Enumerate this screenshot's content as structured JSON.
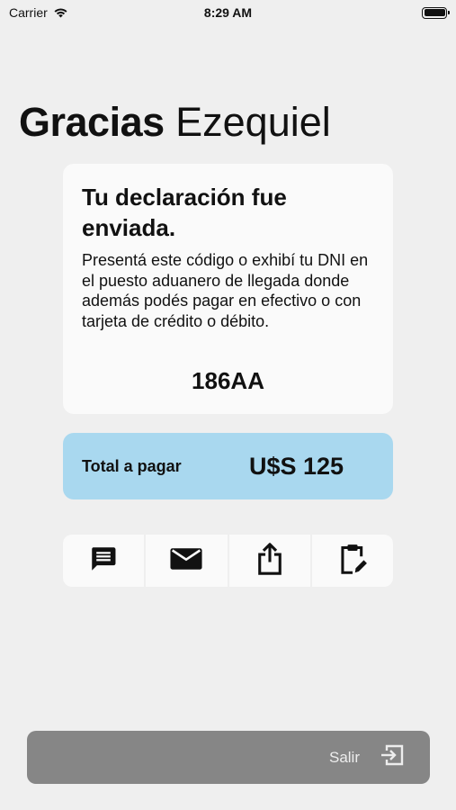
{
  "status_bar": {
    "carrier": "Carrier",
    "time": "8:29 AM"
  },
  "heading": {
    "greeting": "Gracias",
    "name": "Ezequiel"
  },
  "card": {
    "title": "Tu declaración fue enviada.",
    "body": "Presentá este código o exhibí tu DNI en el puesto aduanero de llegada donde además podés pagar en efectivo o con tarjeta de crédito o débito.",
    "code": "186AA"
  },
  "total": {
    "label": "Total a pagar",
    "amount": "U$S 125",
    "background_color": "#a9d8ef"
  },
  "actions": [
    {
      "icon": "message-icon"
    },
    {
      "icon": "mail-icon"
    },
    {
      "icon": "share-icon"
    },
    {
      "icon": "clipboard-edit-icon"
    }
  ],
  "exit": {
    "label": "Salir",
    "icon": "exit-icon",
    "background_color": "#868686"
  }
}
